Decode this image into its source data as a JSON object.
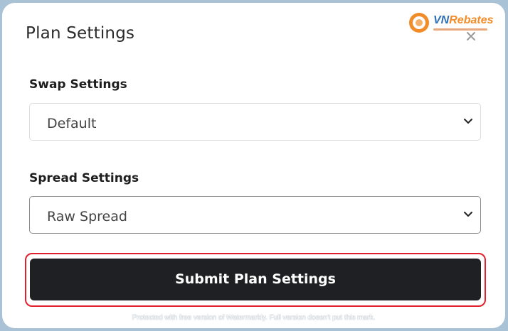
{
  "modal": {
    "title": "Plan Settings",
    "close_icon": "close-icon"
  },
  "logo": {
    "brand_prefix": "VN",
    "brand_suffix": "Rebates"
  },
  "swap": {
    "label": "Swap Settings",
    "selected": "Default"
  },
  "spread": {
    "label": "Spread Settings",
    "selected": "Raw Spread"
  },
  "submit": {
    "label": "Submit Plan Settings"
  },
  "watermark": {
    "text": "Protected with free version of Watermarkly. Full version doesn't put this mark."
  },
  "colors": {
    "button_bg": "#1f2024",
    "highlight_outline": "#e0202c",
    "backdrop": "#a9c2d6",
    "logo_orange": "#f28c28",
    "logo_blue": "#2f6fb5"
  }
}
